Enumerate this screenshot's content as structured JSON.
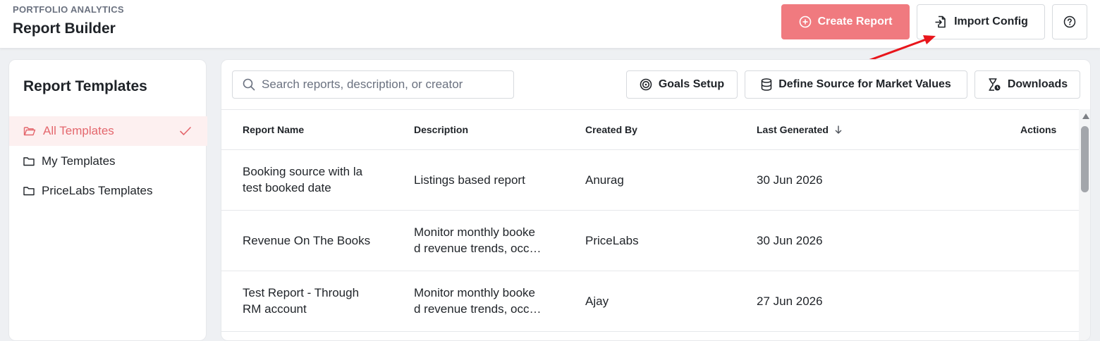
{
  "header": {
    "eyebrow": "PORTFOLIO ANALYTICS",
    "title": "Report Builder",
    "create_label": "Create Report",
    "import_label": "Import Config",
    "help_icon": "question-circle-icon"
  },
  "sidebar": {
    "title": "Report Templates",
    "items": [
      {
        "label": "All Templates",
        "icon": "folder-open-icon",
        "selected": true
      },
      {
        "label": "My Templates",
        "icon": "folder-icon",
        "selected": false
      },
      {
        "label": "PriceLabs Templates",
        "icon": "folder-icon",
        "selected": false
      }
    ]
  },
  "toolbar": {
    "search_placeholder": "Search reports, description, or creator",
    "search_value": "",
    "goals_label": "Goals Setup",
    "source_label": "Define Source for Market Values",
    "downloads_label": "Downloads"
  },
  "table": {
    "columns": [
      "Report Name",
      "Description",
      "Created By",
      "Last Generated",
      "Actions"
    ],
    "sort_column": "Last Generated",
    "sort_direction": "descending",
    "rows": [
      {
        "name": [
          "Booking source with la",
          "test booked date"
        ],
        "description": [
          "Listings based report"
        ],
        "created_by": "Anurag",
        "last_generated": "30 Jun 2026"
      },
      {
        "name": [
          "Revenue On The Books"
        ],
        "description": [
          "Monitor monthly booke",
          "d revenue trends, occ…"
        ],
        "created_by": "PriceLabs",
        "last_generated": "30 Jun 2026"
      },
      {
        "name": [
          "Test Report - Through",
          "RM account"
        ],
        "description": [
          "Monitor monthly booke",
          "d revenue trends, occ…"
        ],
        "created_by": "Ajay",
        "last_generated": "27 Jun 2026"
      }
    ]
  },
  "colors": {
    "accent": "#f07a7f",
    "accent_text": "#e4676d",
    "selected_bg": "#fdf0f0",
    "annotation_arrow": "#e8151b"
  }
}
